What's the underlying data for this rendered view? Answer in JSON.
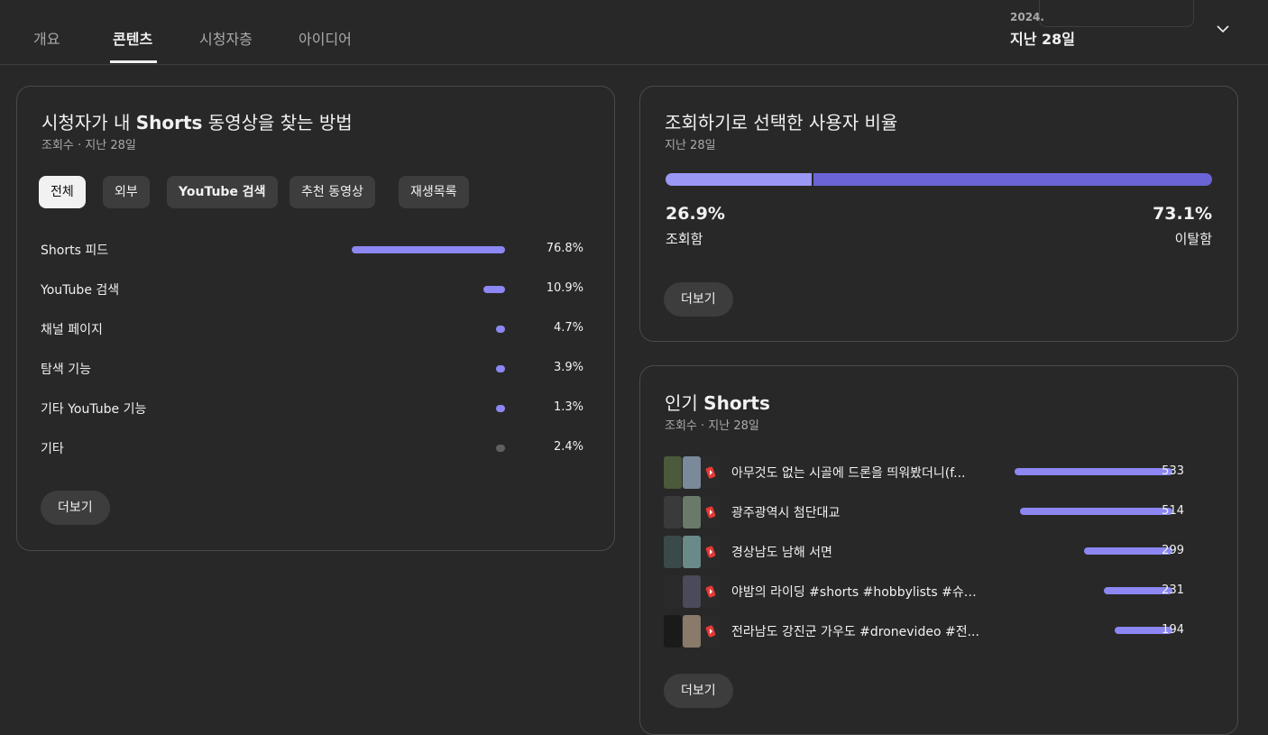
{
  "tabs": [
    {
      "label": "개요"
    },
    {
      "label": "콘텐츠"
    },
    {
      "label": "시청자층"
    },
    {
      "label": "아이디어"
    }
  ],
  "date_picker": {
    "year": "2024.",
    "range": "지난 28일"
  },
  "card_sources": {
    "title_pre": "시청자가 내 ",
    "title_bold": "Shorts",
    "title_post": " 동영상을 찾는 방법",
    "subtitle": "조회수 · 지난 28일",
    "chips": [
      "전체",
      "외부",
      "YouTube 검색",
      "추천 동영상",
      "재생목록"
    ],
    "rows": [
      {
        "label": "Shorts 피드",
        "value": "76.8%",
        "pct": 76.8
      },
      {
        "label": "YouTube 검색",
        "value": "10.9%",
        "pct": 10.9
      },
      {
        "label": "채널 페이지",
        "value": "4.7%",
        "pct": 4.7
      },
      {
        "label": "탐색 기능",
        "value": "3.9%",
        "pct": 3.9
      },
      {
        "label": "기타 YouTube 기능",
        "value": "1.3%",
        "pct": 1.3
      },
      {
        "label": "기타",
        "value": "2.4%",
        "pct": 2.4
      }
    ],
    "more_label": "더보기"
  },
  "card_ratio": {
    "title": "조회하기로 선택한 사용자 비율",
    "subtitle": "지난 28일",
    "viewed_pct": "26.9%",
    "viewed_label": "조회함",
    "swiped_pct": "73.1%",
    "swiped_label": "이탈함",
    "viewed_fraction": 0.269,
    "more_label": "더보기"
  },
  "card_top": {
    "title_pre": "인기 ",
    "title_bold": "Shorts",
    "subtitle": "조회수 · 지난 28일",
    "rows": [
      {
        "title": "아무것도 없는 시골에 드론을 띄워봤더니(f...",
        "value": "533",
        "views": 533
      },
      {
        "title": "광주광역시 첨단대교",
        "value": "514",
        "views": 514
      },
      {
        "title": "경상남도 남해 서면",
        "value": "299",
        "views": 299
      },
      {
        "title": "야밤의 라이딩 #shorts #hobbylists #슈퍼...",
        "value": "231",
        "views": 231
      },
      {
        "title": "전라남도 강진군 가우도 #dronevideo #전...",
        "value": "194",
        "views": 194
      }
    ],
    "more_label": "더보기"
  },
  "colors": {
    "accent": "#8c87f2",
    "accent_dark": "#6a64d6",
    "background": "#282828"
  }
}
